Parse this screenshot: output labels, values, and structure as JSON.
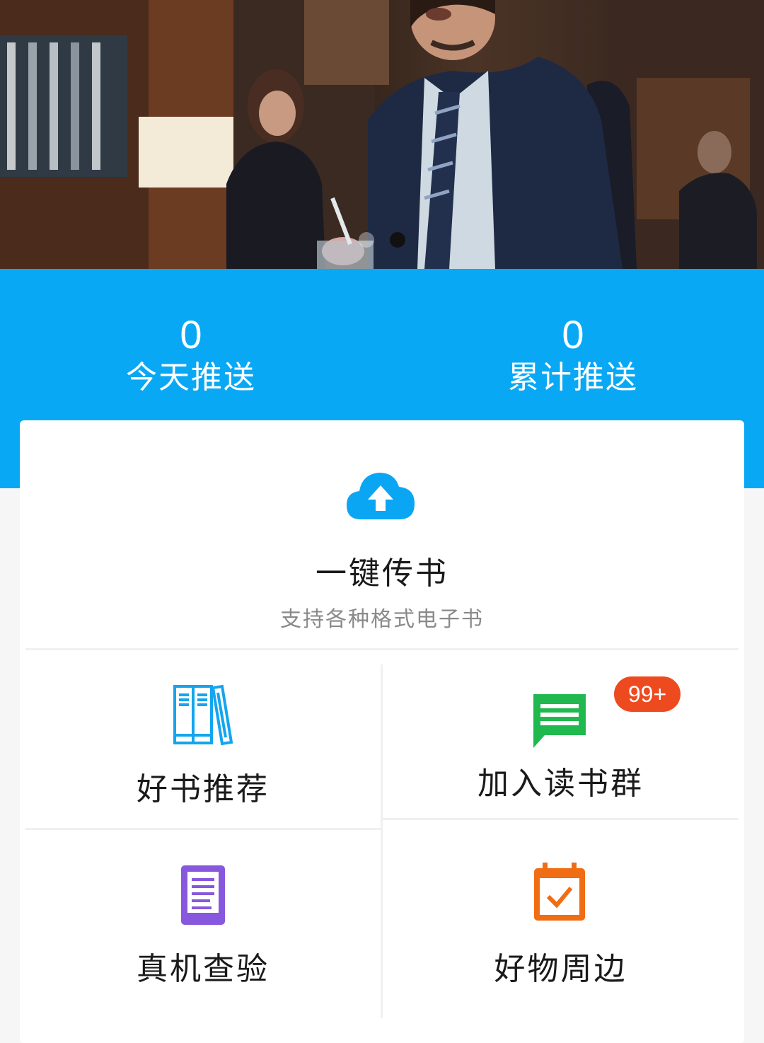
{
  "banner": {
    "slide_count": 2,
    "active_slide": 2
  },
  "stats": {
    "today": {
      "value": "0",
      "label": "今天推送"
    },
    "total": {
      "value": "0",
      "label": "累计推送"
    }
  },
  "upload": {
    "title": "一键传书",
    "subtitle": "支持各种格式电子书",
    "icon": "cloud-upload-icon",
    "color": "#0aa6f4"
  },
  "tiles": [
    {
      "label": "好书推荐",
      "icon": "books-icon",
      "color": "#14a5ee"
    },
    {
      "label": "加入读书群",
      "icon": "chat-message-icon",
      "color": "#21b94f",
      "badge": "99+",
      "badge_color": "#ee4a1f"
    },
    {
      "label": "真机查验",
      "icon": "document-icon",
      "color": "#8758dd"
    },
    {
      "label": "好物周边",
      "icon": "calendar-check-icon",
      "color": "#f06d13"
    }
  ],
  "colors": {
    "stats_background": "#09a8f5",
    "page_background": "#f6f6f7"
  }
}
